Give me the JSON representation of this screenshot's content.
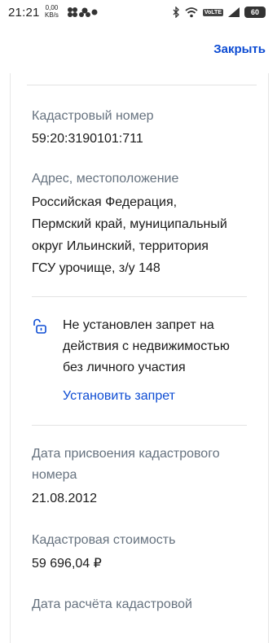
{
  "status_bar": {
    "time": "21:21",
    "speed_value": "0,00",
    "speed_unit": "KB/s",
    "network": "VoLTE",
    "battery": "60"
  },
  "topbar": {
    "close_label": "Закрыть"
  },
  "card": {
    "cadastral_number_label": "Кадастровый номер",
    "cadastral_number": "59:20:3190101:711",
    "address_label": "Адрес, местоположение",
    "address_line1": "Российская Федерация,",
    "address_line2": "Пермский край, муниципальный",
    "address_line3": "округ Ильинский, территория",
    "address_line4": "ГСУ урочище, з/у 148",
    "ban_line1": "Не установлен запрет на",
    "ban_line2": "действия с недвижимостью",
    "ban_line3": "без личного участия",
    "ban_link": "Установить запрет",
    "assign_date_label_line1": "Дата присвоения кадастрового",
    "assign_date_label_line2": "номера",
    "assign_date": "21.08.2012",
    "cost_label": "Кадастровая стоимость",
    "cost": "59 696,04 ₽",
    "calc_date_label_partial": "Дата расчёта кадастровой"
  }
}
